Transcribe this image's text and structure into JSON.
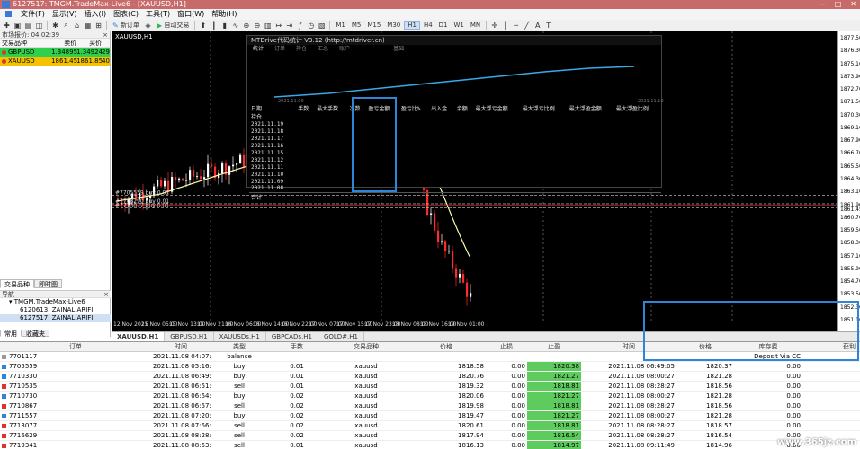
{
  "window": {
    "title": "6127517: TMGM.TradeMax-Live6 - [XAUUSD,H1]",
    "minimize": "—",
    "maximize": "□",
    "close": "✕"
  },
  "menu": {
    "items": [
      "文件(F)",
      "显示(V)",
      "插入(I)",
      "图表(C)",
      "工具(T)",
      "窗口(W)",
      "帮助(H)"
    ]
  },
  "toolbar": {
    "new_order": "新订单",
    "auto_trading": "自动交易",
    "timeframes": [
      "M1",
      "M5",
      "M15",
      "M30",
      "H1",
      "H4",
      "D1",
      "W1",
      "MN"
    ],
    "active_timeframe": "H1",
    "icons": [
      "new-chart-icon",
      "open-icon",
      "save-icon",
      "profiles-icon",
      "market-watch-icon",
      "data-window-icon",
      "navigator-icon",
      "terminal-icon",
      "tester-icon",
      "new-order-icon",
      "metaeditor-icon",
      "auto-trading-icon"
    ]
  },
  "market_watch": {
    "title": "市场报价: 04:02:39",
    "close": "×",
    "columns": [
      "交易品种",
      "卖价",
      "买价",
      ""
    ],
    "rows": [
      {
        "symbol": "GBPUSD",
        "bid": "1.34895",
        "ask": "1.34924",
        "spread": "29",
        "state": "up"
      },
      {
        "symbol": "XAUUSD",
        "bid": "1861.45",
        "ask": "1861.85",
        "spread": "40",
        "state": "down"
      }
    ],
    "tabs": [
      "交易品种",
      "即时图"
    ]
  },
  "navigator": {
    "title": "导航",
    "items": [
      {
        "label": "TMGM.TradeMax-Live6",
        "level": 1
      },
      {
        "label": "6120613: ZAINAL ARIFI",
        "level": 2
      },
      {
        "label": "6127517: ZAINAL ARIFI",
        "level": 2
      }
    ],
    "tabs": [
      "常用",
      "收藏夹"
    ]
  },
  "chart": {
    "caption": "XAUUSD,H1",
    "background": "#000000",
    "bull_color": "#ffffff",
    "bear_color": "#ff2a2a",
    "line_color": "#ffffaa",
    "grid_color": "#555555",
    "price_ticks": [
      "1877.50",
      "1876.30",
      "1875.10",
      "1873.90",
      "1872.70",
      "1871.50",
      "1870.30",
      "1869.10",
      "1867.90",
      "1866.70",
      "1865.50",
      "1864.30",
      "1863.10",
      "1861.90",
      "1860.70",
      "1859.50",
      "1858.30",
      "1857.10",
      "1855.90",
      "1854.70",
      "1853.50",
      "1852.30",
      "1851.10"
    ],
    "current_price": "1861.45",
    "line_price": "1861.85",
    "time_ticks": [
      "12 Nov 2021",
      "15 Nov 05:00",
      "15 Nov 13:00",
      "15 Nov 21:00",
      "16 Nov 06:00",
      "16 Nov 14:00",
      "16 Nov 22:00",
      "17 Nov 07:00",
      "17 Nov 15:00",
      "17 Nov 23:00",
      "18 Nov 08:00",
      "18 Nov 16:00",
      "19 Nov 01:00"
    ],
    "order_labels": [
      "#7705559 buy 0.01",
      "#7708290 buy 0.01",
      "#7713077 buy 0.01"
    ]
  },
  "chart_tabs": [
    "XAUUSD,H1",
    "GBPUSD,H1",
    "XAUUSDs,H1",
    "GBPCADs,H1",
    "GOLD#,H1"
  ],
  "stats": {
    "title": "MTDrive代码统计 V3.12 (http://mtdriver.cn)",
    "tabs": [
      "统计",
      "订单",
      "持仓",
      "汇总",
      "账户",
      "",
      "",
      "",
      "基础"
    ],
    "equity_range_left": "2021.11.09",
    "equity_range_right": "2021.11.19",
    "columns": [
      "日期",
      "手数",
      "最大手数",
      "次数",
      "盈亏金额",
      "盈亏比%",
      "出入金",
      "余额",
      "最大浮亏金额",
      "最大浮亏比例",
      "最大浮盈金额",
      "最大浮盈比例"
    ],
    "rows": [
      {
        "cells": [
          "持仓",
          "",
          "",
          "",
          "",
          "",
          "",
          "",
          "",
          "",
          "",
          ""
        ]
      },
      {
        "cells": [
          "2021.11.19",
          "",
          "",
          "",
          "",
          "",
          "",
          "",
          "",
          "",
          "",
          ""
        ]
      },
      {
        "cells": [
          "2021.11.18",
          "",
          "",
          "",
          "",
          "",
          "",
          "",
          "",
          "",
          "",
          ""
        ]
      },
      {
        "cells": [
          "2021.11.17",
          "",
          "",
          "",
          "",
          "",
          "",
          "",
          "",
          "",
          "",
          ""
        ]
      },
      {
        "cells": [
          "2021.11.16",
          "",
          "",
          "",
          "",
          "",
          "",
          "",
          "",
          "",
          "",
          ""
        ]
      },
      {
        "cells": [
          "2021.11.15",
          "",
          "",
          "",
          "",
          "",
          "",
          "",
          "",
          "",
          "",
          ""
        ]
      },
      {
        "cells": [
          "2021.11.12",
          "",
          "",
          "",
          "",
          "",
          "",
          "",
          "",
          "",
          "",
          ""
        ]
      },
      {
        "cells": [
          "2021.11.11",
          "",
          "",
          "",
          "",
          "",
          "",
          "",
          "",
          "",
          "",
          ""
        ]
      },
      {
        "cells": [
          "2021.11.10",
          "",
          "",
          "",
          "",
          "",
          "",
          "",
          "",
          "",
          "",
          ""
        ]
      },
      {
        "cells": [
          "2021.11.09",
          "",
          "",
          "",
          "",
          "",
          "",
          "",
          "",
          "",
          "",
          ""
        ]
      },
      {
        "cells": [
          "2021.11.08",
          "",
          "",
          "",
          "",
          "",
          "",
          "",
          "",
          "",
          "",
          ""
        ]
      },
      {
        "cells": [
          "合计",
          "",
          "",
          "",
          "",
          "",
          "",
          "",
          "",
          "",
          "",
          ""
        ],
        "total": true
      }
    ]
  },
  "orders": {
    "columns": [
      "订单",
      "时间",
      "类型",
      "手数",
      "交易品种",
      "价格",
      "止损",
      "止盈",
      "时间",
      "价格",
      "库存费",
      "获利"
    ],
    "rows": [
      {
        "order": "7701117",
        "time": "2021.11.08 04:07:12",
        "type": "balance",
        "lots": "",
        "symbol": "",
        "price": "",
        "sl": "",
        "tp": "",
        "ctime": "",
        "cprice": "",
        "swap": "Deposit Via CC",
        "profit": "4 000.00"
      },
      {
        "order": "7705559",
        "time": "2021.11.08 05:16:24",
        "type": "buy",
        "lots": "0.01",
        "symbol": "xauusd",
        "price": "1818.58",
        "sl": "0.00",
        "tp": "1820.38",
        "ctime": "2021.11.08 06:49:05",
        "cprice": "1820.37",
        "swap": "0.00",
        "profit": "1.79"
      },
      {
        "order": "7710330",
        "time": "2021.11.08 06:49:06",
        "type": "buy",
        "lots": "0.01",
        "symbol": "xauusd",
        "price": "1820.76",
        "sl": "0.00",
        "tp": "1821.27",
        "ctime": "2021.11.08 08:00:27",
        "cprice": "1821.28",
        "swap": "0.00",
        "profit": "0.52"
      },
      {
        "order": "7710535",
        "time": "2021.11.08 06:51:49",
        "type": "sell",
        "lots": "0.01",
        "symbol": "xauusd",
        "price": "1819.32",
        "sl": "0.00",
        "tp": "1818.81",
        "ctime": "2021.11.08 08:28:27",
        "cprice": "1818.56",
        "swap": "0.00",
        "profit": "0.76"
      },
      {
        "order": "7710730",
        "time": "2021.11.08 06:54:00",
        "type": "buy",
        "lots": "0.02",
        "symbol": "xauusd",
        "price": "1820.06",
        "sl": "0.00",
        "tp": "1821.27",
        "ctime": "2021.11.08 08:00:27",
        "cprice": "1821.28",
        "swap": "0.00",
        "profit": "2.44"
      },
      {
        "order": "7710867",
        "time": "2021.11.08 06:57:02",
        "type": "sell",
        "lots": "0.02",
        "symbol": "xauusd",
        "price": "1819.98",
        "sl": "0.00",
        "tp": "1818.81",
        "ctime": "2021.11.08 08:28:27",
        "cprice": "1818.56",
        "swap": "0.00",
        "profit": "2.84"
      },
      {
        "order": "7711557",
        "time": "2021.11.08 07:20:40",
        "type": "buy",
        "lots": "0.02",
        "symbol": "xauusd",
        "price": "1819.47",
        "sl": "0.00",
        "tp": "1821.27",
        "ctime": "2021.11.08 08:00:27",
        "cprice": "1821.28",
        "swap": "0.00",
        "profit": "3.62"
      },
      {
        "order": "7713077",
        "time": "2021.11.08 07:56:53",
        "type": "sell",
        "lots": "0.02",
        "symbol": "xauusd",
        "price": "1820.61",
        "sl": "0.00",
        "tp": "1818.81",
        "ctime": "2021.11.08 08:28:27",
        "cprice": "1818.57",
        "swap": "0.00",
        "profit": "4.08"
      },
      {
        "order": "7716629",
        "time": "2021.11.08 08:28:28",
        "type": "sell",
        "lots": "0.02",
        "symbol": "xauusd",
        "price": "1817.94",
        "sl": "0.00",
        "tp": "1816.54",
        "ctime": "2021.11.08 08:28:27",
        "cprice": "1816.54",
        "swap": "0.00",
        "profit": "2.80"
      },
      {
        "order": "7719341",
        "time": "2021.11.08 08:53:52",
        "type": "sell",
        "lots": "0.01",
        "symbol": "xauusd",
        "price": "1816.13",
        "sl": "0.00",
        "tp": "1814.97",
        "ctime": "2021.11.08 09:11:49",
        "cprice": "1814.96",
        "swap": "0.00",
        "profit": "1.17"
      }
    ],
    "highlight_color": "#5ecb5e"
  },
  "watermark": "www.365jz.com"
}
